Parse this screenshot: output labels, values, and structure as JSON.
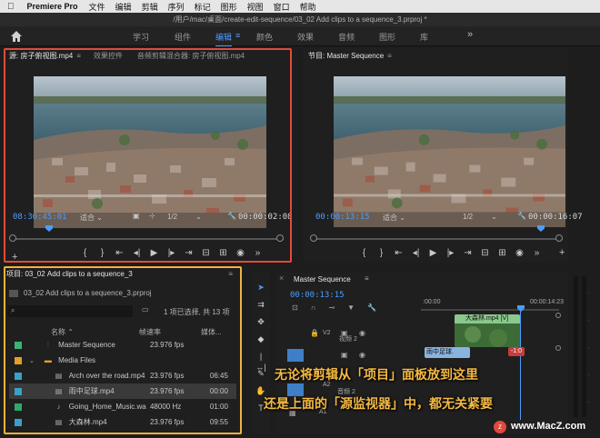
{
  "menubar": {
    "app": "Premiere Pro",
    "items": [
      "文件",
      "编辑",
      "剪辑",
      "序列",
      "标记",
      "图形",
      "视图",
      "窗口",
      "帮助"
    ]
  },
  "window_title": "/用户/mac/桌面/create-edit-sequence/03_02 Add clips to a sequence_3.prproj *",
  "workspace": {
    "tabs": [
      "学习",
      "组件",
      "编辑",
      "颜色",
      "效果",
      "音频",
      "图形",
      "库"
    ],
    "active": "编辑",
    "more": "»"
  },
  "source_monitor": {
    "tabs": [
      "源: 房子俯视图.mp4",
      "效果控件",
      "音频剪辑混合器: 房子俯视图.mp4"
    ],
    "timecode": "08:30:45:01",
    "fit": "适合",
    "resolution": "1/2",
    "duration": "00:00:02:08"
  },
  "program_monitor": {
    "title": "节目: Master Sequence",
    "timecode": "00:00:13:15",
    "fit": "适合",
    "resolution": "1/2",
    "duration": "00:00:16:07"
  },
  "project": {
    "title": "项目: 03_02 Add clips to a sequence_3",
    "file": "03_02 Add clips to a sequence_3.prproj",
    "selection_info": "1 项已选择, 共 13 项",
    "columns": {
      "name": "名称",
      "rate": "帧速率",
      "media": "媒体..."
    },
    "rows": [
      {
        "name": "Master Sequence",
        "rate": "23.976 fps",
        "media": "",
        "color": "#3cb371",
        "icon": "seq"
      },
      {
        "name": "Media Files",
        "rate": "",
        "media": "",
        "color": "#e0a02a",
        "icon": "folder"
      },
      {
        "name": "Arch over the road.mp4",
        "rate": "23.976 fps",
        "media": "06:45",
        "color": "#3aa0c8",
        "icon": "clip"
      },
      {
        "name": "雨中足球.mp4",
        "rate": "23.976 fps",
        "media": "00:00",
        "color": "#3aa0c8",
        "icon": "clip"
      },
      {
        "name": "Going_Home_Music.wa",
        "rate": "48000 Hz",
        "media": "01:00",
        "color": "#2fa868",
        "icon": "audio"
      },
      {
        "name": "大森林.mp4",
        "rate": "23.976 fps",
        "media": "09:55",
        "color": "#3aa0c8",
        "icon": "clip"
      }
    ]
  },
  "timeline": {
    "title": "Master Sequence",
    "timecode": "00:00:13:15",
    "ruler": [
      ":00:00",
      "00:00:14:23"
    ],
    "tracks": {
      "v2": "V2",
      "v2_label": "视频 2",
      "a1": "A1",
      "a2": "A2",
      "a2_label": "音频 2"
    },
    "clips": {
      "forest": "大森林.mp4 [V]",
      "football": "雨中足球.",
      "fx": "-1:0"
    }
  },
  "captions": {
    "line1": "无论将剪辑从「项目」面板放到这里",
    "line2": "还是上面的「源监视器」中，都无关紧要"
  },
  "watermark": "www.MacZ.com"
}
